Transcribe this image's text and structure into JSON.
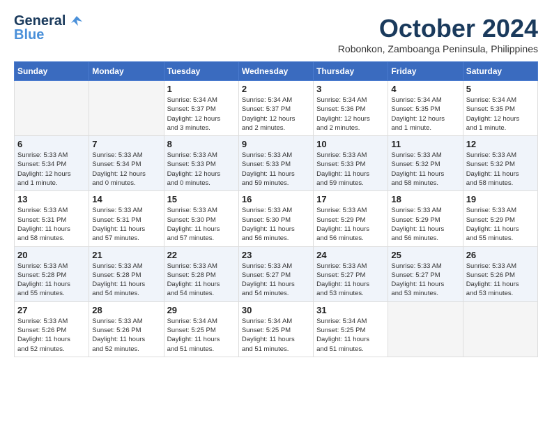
{
  "header": {
    "logo_line1": "General",
    "logo_line2": "Blue",
    "month": "October 2024",
    "location": "Robonkon, Zamboanga Peninsula, Philippines"
  },
  "columns": [
    "Sunday",
    "Monday",
    "Tuesday",
    "Wednesday",
    "Thursday",
    "Friday",
    "Saturday"
  ],
  "weeks": [
    [
      {
        "day": "",
        "detail": ""
      },
      {
        "day": "",
        "detail": ""
      },
      {
        "day": "1",
        "detail": "Sunrise: 5:34 AM\nSunset: 5:37 PM\nDaylight: 12 hours\nand 3 minutes."
      },
      {
        "day": "2",
        "detail": "Sunrise: 5:34 AM\nSunset: 5:37 PM\nDaylight: 12 hours\nand 2 minutes."
      },
      {
        "day": "3",
        "detail": "Sunrise: 5:34 AM\nSunset: 5:36 PM\nDaylight: 12 hours\nand 2 minutes."
      },
      {
        "day": "4",
        "detail": "Sunrise: 5:34 AM\nSunset: 5:35 PM\nDaylight: 12 hours\nand 1 minute."
      },
      {
        "day": "5",
        "detail": "Sunrise: 5:34 AM\nSunset: 5:35 PM\nDaylight: 12 hours\nand 1 minute."
      }
    ],
    [
      {
        "day": "6",
        "detail": "Sunrise: 5:33 AM\nSunset: 5:34 PM\nDaylight: 12 hours\nand 1 minute."
      },
      {
        "day": "7",
        "detail": "Sunrise: 5:33 AM\nSunset: 5:34 PM\nDaylight: 12 hours\nand 0 minutes."
      },
      {
        "day": "8",
        "detail": "Sunrise: 5:33 AM\nSunset: 5:33 PM\nDaylight: 12 hours\nand 0 minutes."
      },
      {
        "day": "9",
        "detail": "Sunrise: 5:33 AM\nSunset: 5:33 PM\nDaylight: 11 hours\nand 59 minutes."
      },
      {
        "day": "10",
        "detail": "Sunrise: 5:33 AM\nSunset: 5:33 PM\nDaylight: 11 hours\nand 59 minutes."
      },
      {
        "day": "11",
        "detail": "Sunrise: 5:33 AM\nSunset: 5:32 PM\nDaylight: 11 hours\nand 58 minutes."
      },
      {
        "day": "12",
        "detail": "Sunrise: 5:33 AM\nSunset: 5:32 PM\nDaylight: 11 hours\nand 58 minutes."
      }
    ],
    [
      {
        "day": "13",
        "detail": "Sunrise: 5:33 AM\nSunset: 5:31 PM\nDaylight: 11 hours\nand 58 minutes."
      },
      {
        "day": "14",
        "detail": "Sunrise: 5:33 AM\nSunset: 5:31 PM\nDaylight: 11 hours\nand 57 minutes."
      },
      {
        "day": "15",
        "detail": "Sunrise: 5:33 AM\nSunset: 5:30 PM\nDaylight: 11 hours\nand 57 minutes."
      },
      {
        "day": "16",
        "detail": "Sunrise: 5:33 AM\nSunset: 5:30 PM\nDaylight: 11 hours\nand 56 minutes."
      },
      {
        "day": "17",
        "detail": "Sunrise: 5:33 AM\nSunset: 5:29 PM\nDaylight: 11 hours\nand 56 minutes."
      },
      {
        "day": "18",
        "detail": "Sunrise: 5:33 AM\nSunset: 5:29 PM\nDaylight: 11 hours\nand 56 minutes."
      },
      {
        "day": "19",
        "detail": "Sunrise: 5:33 AM\nSunset: 5:29 PM\nDaylight: 11 hours\nand 55 minutes."
      }
    ],
    [
      {
        "day": "20",
        "detail": "Sunrise: 5:33 AM\nSunset: 5:28 PM\nDaylight: 11 hours\nand 55 minutes."
      },
      {
        "day": "21",
        "detail": "Sunrise: 5:33 AM\nSunset: 5:28 PM\nDaylight: 11 hours\nand 54 minutes."
      },
      {
        "day": "22",
        "detail": "Sunrise: 5:33 AM\nSunset: 5:28 PM\nDaylight: 11 hours\nand 54 minutes."
      },
      {
        "day": "23",
        "detail": "Sunrise: 5:33 AM\nSunset: 5:27 PM\nDaylight: 11 hours\nand 54 minutes."
      },
      {
        "day": "24",
        "detail": "Sunrise: 5:33 AM\nSunset: 5:27 PM\nDaylight: 11 hours\nand 53 minutes."
      },
      {
        "day": "25",
        "detail": "Sunrise: 5:33 AM\nSunset: 5:27 PM\nDaylight: 11 hours\nand 53 minutes."
      },
      {
        "day": "26",
        "detail": "Sunrise: 5:33 AM\nSunset: 5:26 PM\nDaylight: 11 hours\nand 53 minutes."
      }
    ],
    [
      {
        "day": "27",
        "detail": "Sunrise: 5:33 AM\nSunset: 5:26 PM\nDaylight: 11 hours\nand 52 minutes."
      },
      {
        "day": "28",
        "detail": "Sunrise: 5:33 AM\nSunset: 5:26 PM\nDaylight: 11 hours\nand 52 minutes."
      },
      {
        "day": "29",
        "detail": "Sunrise: 5:34 AM\nSunset: 5:25 PM\nDaylight: 11 hours\nand 51 minutes."
      },
      {
        "day": "30",
        "detail": "Sunrise: 5:34 AM\nSunset: 5:25 PM\nDaylight: 11 hours\nand 51 minutes."
      },
      {
        "day": "31",
        "detail": "Sunrise: 5:34 AM\nSunset: 5:25 PM\nDaylight: 11 hours\nand 51 minutes."
      },
      {
        "day": "",
        "detail": ""
      },
      {
        "day": "",
        "detail": ""
      }
    ]
  ]
}
